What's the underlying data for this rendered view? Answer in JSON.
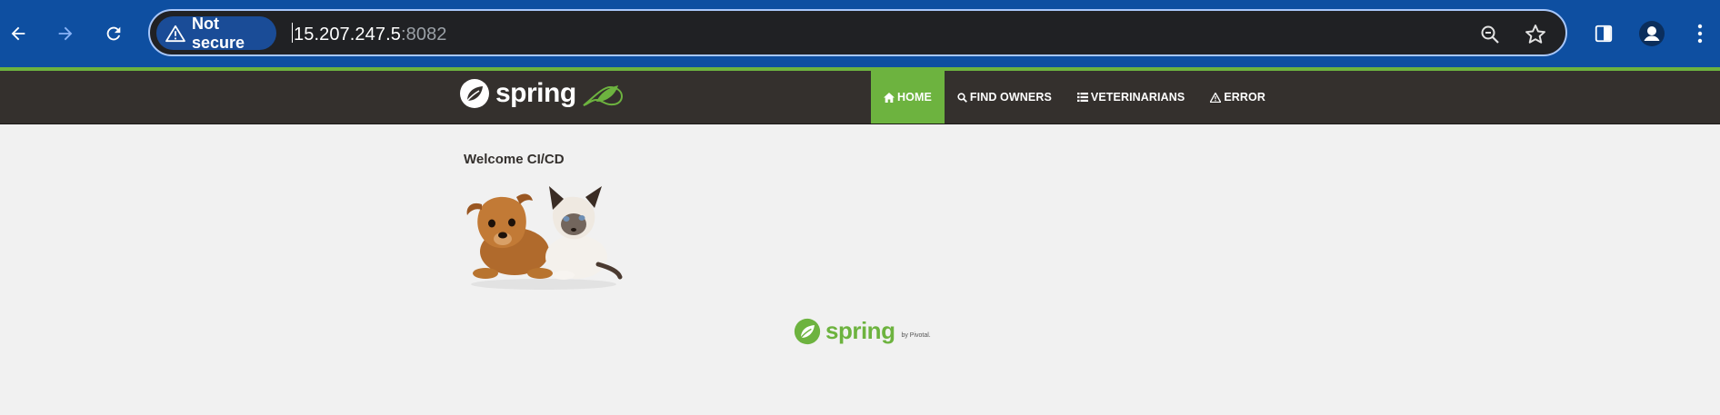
{
  "browser": {
    "security_chip": "Not secure",
    "url_host": "15.207.247.5",
    "url_port": ":8082",
    "icons": [
      "back-icon",
      "forward-icon",
      "reload-icon",
      "warning-icon",
      "zoom-icon",
      "bookmark-star-icon",
      "side-panel-icon",
      "profile-icon",
      "menu-icon"
    ]
  },
  "navbar": {
    "brand": "spring",
    "items": [
      {
        "label": "HOME",
        "icon": "home-icon",
        "active": true
      },
      {
        "label": "FIND OWNERS",
        "icon": "search-icon",
        "active": false
      },
      {
        "label": "VETERINARIANS",
        "icon": "list-icon",
        "active": false
      },
      {
        "label": "ERROR",
        "icon": "warning-icon",
        "active": false
      }
    ]
  },
  "main": {
    "heading": "Welcome CI/CD"
  },
  "footer": {
    "brand": "spring",
    "byline": "by Pivotal."
  },
  "colors": {
    "chrome_bg": "#0e4fa1",
    "nav_bg": "#34302d",
    "accent_green": "#6db33f",
    "page_bg": "#f1f1f1"
  }
}
